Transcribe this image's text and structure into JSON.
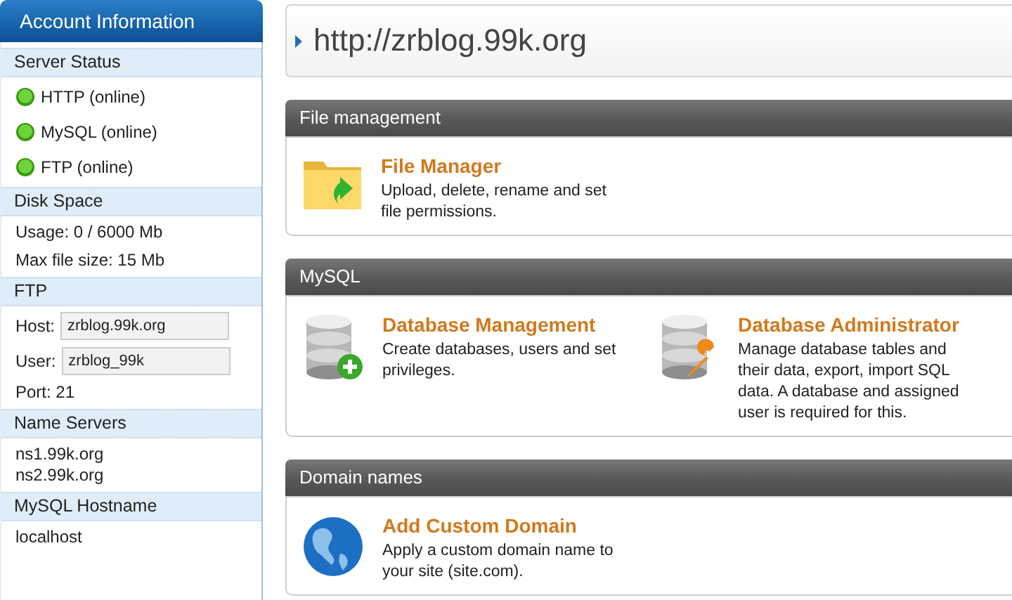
{
  "sidebar": {
    "title": "Account Information",
    "sections": [
      {
        "kind": "status",
        "heading": "Server Status",
        "items": [
          "HTTP (online)",
          "MySQL (online)",
          "FTP (online)"
        ]
      },
      {
        "kind": "lines",
        "heading": "Disk Space",
        "lines": [
          "Usage: 0 / 6000 Mb",
          "Max file size: 15 Mb"
        ]
      },
      {
        "kind": "fields",
        "heading": "FTP",
        "fields": [
          {
            "label": "Host:",
            "value": "zrblog.99k.org"
          },
          {
            "label": "User:",
            "value": "zrblog_99k"
          }
        ],
        "lines": [
          "Port: 21"
        ]
      },
      {
        "kind": "compact",
        "heading": "Name Servers",
        "lines": [
          "ns1.99k.org",
          "ns2.99k.org"
        ]
      },
      {
        "kind": "lines",
        "heading": "MySQL Hostname",
        "lines": [
          "localhost"
        ]
      }
    ]
  },
  "address": "http://zrblog.99k.org",
  "sections": [
    {
      "heading": "File management",
      "tools": [
        {
          "kind": "folder",
          "title": "File Manager",
          "description": "Upload, delete, rename and set file permissions."
        }
      ]
    },
    {
      "heading": "MySQL",
      "tools": [
        {
          "kind": "database-add",
          "title": "Database Management",
          "description": "Create databases, users and set privileges."
        },
        {
          "kind": "database-wrench",
          "title": "Database Administrator",
          "description": "Manage database tables and their data, export, import SQL data. A database and assigned user is required for this."
        }
      ]
    },
    {
      "heading": "Domain names",
      "tools": [
        {
          "kind": "globe",
          "title": "Add Custom Domain",
          "description": "Apply a custom domain name to your site (site.com)."
        }
      ]
    }
  ]
}
